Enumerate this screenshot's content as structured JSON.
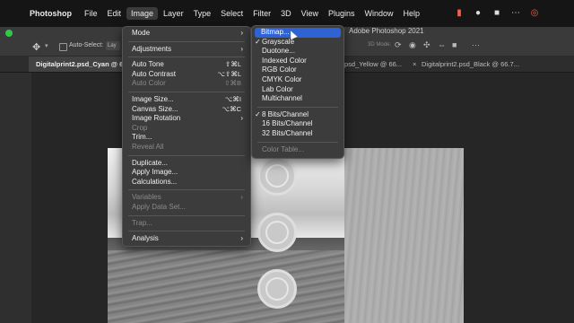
{
  "menubar": {
    "app": "Photoshop",
    "items": [
      "File",
      "Edit",
      "Image",
      "Layer",
      "Type",
      "Select",
      "Filter",
      "3D",
      "View",
      "Plugins",
      "Window",
      "Help"
    ]
  },
  "options": {
    "auto_select": "Auto-Select:",
    "layer_value": "Lay",
    "mode_3d": "3D Mode:"
  },
  "window": {
    "title": "Adobe Photoshop 2021"
  },
  "tabs": [
    "Digitalprint2.psd_Cyan @ 6",
    "psd_Yellow @ 66...",
    "Digitalprint2.psd_Black @ 66.7..."
  ],
  "image_menu": {
    "items": [
      {
        "label": "Mode",
        "arrow": "›"
      },
      {
        "label": "Adjustments",
        "arrow": "›"
      },
      {
        "label": "Auto Tone",
        "shortcut": "⇧⌘L"
      },
      {
        "label": "Auto Contrast",
        "shortcut": "⌥⇧⌘L"
      },
      {
        "label": "Auto Color",
        "shortcut": "⇧⌘B"
      },
      {
        "label": "Image Size...",
        "shortcut": "⌥⌘I"
      },
      {
        "label": "Canvas Size...",
        "shortcut": "⌥⌘C"
      },
      {
        "label": "Image Rotation",
        "arrow": "›"
      },
      {
        "label": "Crop"
      },
      {
        "label": "Trim..."
      },
      {
        "label": "Reveal All"
      },
      {
        "label": "Duplicate..."
      },
      {
        "label": "Apply Image..."
      },
      {
        "label": "Calculations..."
      },
      {
        "label": "Variables",
        "arrow": "›"
      },
      {
        "label": "Apply Data Set..."
      },
      {
        "label": "Trap..."
      },
      {
        "label": "Analysis",
        "arrow": "›"
      }
    ]
  },
  "mode_submenu": {
    "items": [
      "Bitmap...",
      "Grayscale",
      "Duotone...",
      "Indexed Color",
      "RGB Color",
      "CMYK Color",
      "Lab Color",
      "Multichannel",
      "8 Bits/Channel",
      "16 Bits/Channel",
      "32 Bits/Channel",
      "Color Table..."
    ],
    "checkmark": "✓"
  },
  "icons": {
    "move": "move-tool-icon",
    "spotlight": "status-icons"
  },
  "colors": {
    "highlight": "#2f62d2",
    "menu_bg": "#3c3c3c"
  }
}
